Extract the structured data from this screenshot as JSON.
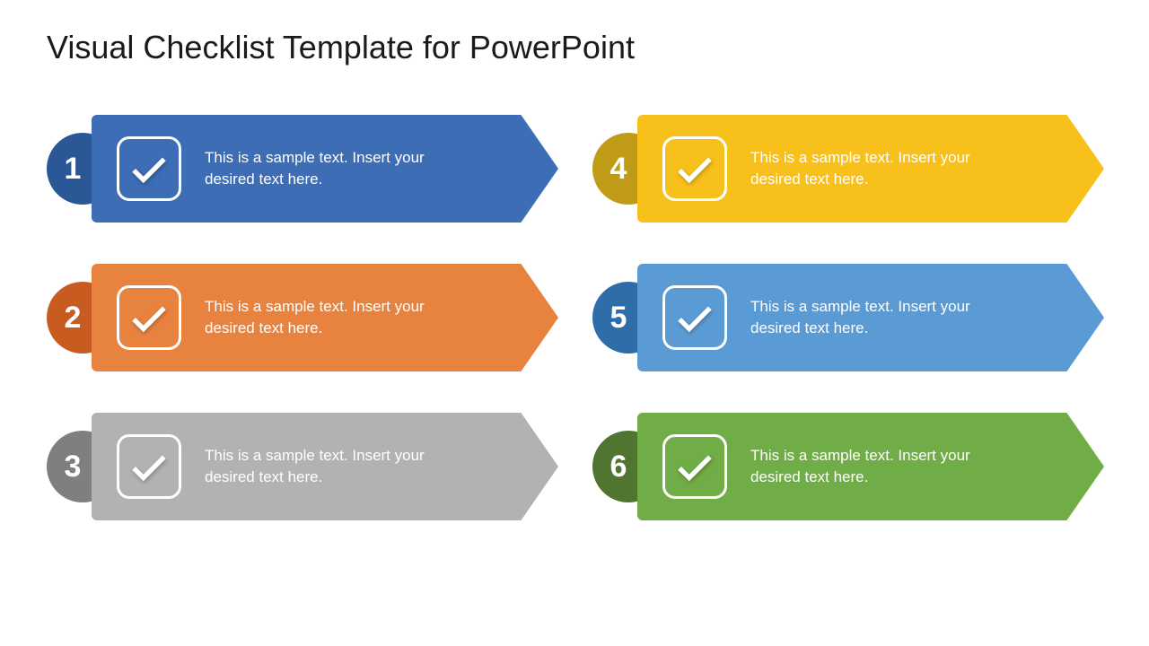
{
  "title": "Visual Checklist Template for PowerPoint",
  "items": [
    {
      "num": "1",
      "text": "This is a sample text. Insert your desired text here.",
      "circleColor": "#2b5797",
      "arrowColor": "#3d6db5"
    },
    {
      "num": "2",
      "text": "This is a sample text. Insert your desired text here.",
      "circleColor": "#c75b20",
      "arrowColor": "#e8833f"
    },
    {
      "num": "3",
      "text": "This is a sample text. Insert your desired text here.",
      "circleColor": "#7f7f7f",
      "arrowColor": "#b2b2b2"
    },
    {
      "num": "4",
      "text": "This is a sample text. Insert your desired text here.",
      "circleColor": "#bf9b18",
      "arrowColor": "#f8c01b"
    },
    {
      "num": "5",
      "text": "This is a sample text. Insert your desired text here.",
      "circleColor": "#2f6da8",
      "arrowColor": "#5b9bd5"
    },
    {
      "num": "6",
      "text": "This is a sample text. Insert your desired text here.",
      "circleColor": "#4f7530",
      "arrowColor": "#70ad47"
    }
  ]
}
